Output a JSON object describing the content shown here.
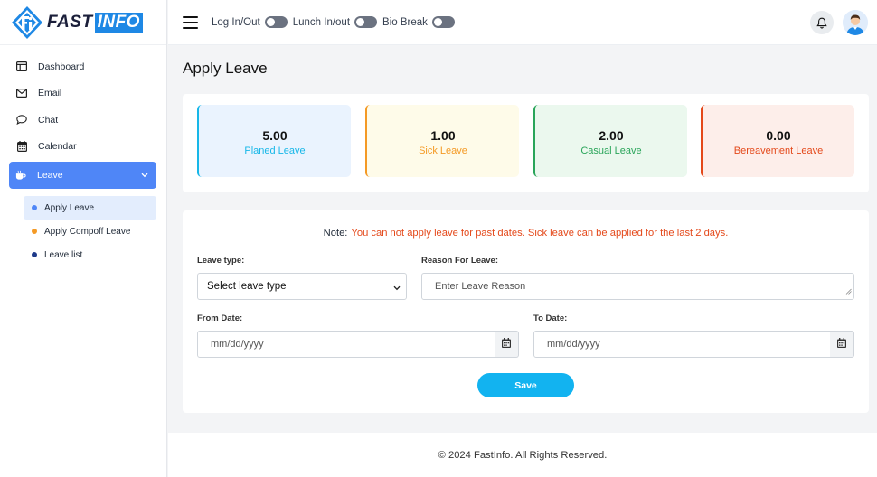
{
  "brand": {
    "name_part1": "FAST",
    "name_part2": "INFO",
    "colors": {
      "primary": "#1e88e5",
      "dark": "#1b1f3a"
    }
  },
  "sidebar": {
    "items": [
      {
        "label": "Dashboard",
        "icon": "dashboard-icon"
      },
      {
        "label": "Email",
        "icon": "mail-icon"
      },
      {
        "label": "Chat",
        "icon": "chat-icon"
      },
      {
        "label": "Calendar",
        "icon": "calendar-icon"
      },
      {
        "label": "Leave",
        "icon": "coffee-icon",
        "active": true
      }
    ],
    "leave_submenu": [
      {
        "label": "Apply Leave",
        "dot_color": "#4f86f7",
        "active": true
      },
      {
        "label": "Apply Compoff Leave",
        "dot_color": "#f49a25"
      },
      {
        "label": "Leave list",
        "dot_color": "#1e3a8a"
      }
    ]
  },
  "header": {
    "toggles": [
      {
        "label": "Log In/Out",
        "on": false
      },
      {
        "label": "Lunch In/out",
        "on": false
      },
      {
        "label": "Bio Break",
        "on": false
      }
    ]
  },
  "page": {
    "title": "Apply Leave"
  },
  "stats": [
    {
      "value": "5.00",
      "label": "Planed Leave",
      "color": "#17b7e8"
    },
    {
      "value": "1.00",
      "label": "Sick Leave",
      "color": "#f49a25"
    },
    {
      "value": "2.00",
      "label": "Casual Leave",
      "color": "#2aa55a"
    },
    {
      "value": "0.00",
      "label": "Bereavement Leave",
      "color": "#e4491b"
    }
  ],
  "form": {
    "note_label": "Note:",
    "note_text": "You can not apply leave for past dates. Sick leave can be applied for the last 2 days.",
    "leave_type_label": "Leave type:",
    "leave_type_value": "Select leave type",
    "reason_label": "Reason For Leave:",
    "reason_placeholder": "Enter Leave Reason",
    "from_label": "From Date:",
    "from_placeholder": "mm/dd/yyyy",
    "to_label": "To Date:",
    "to_placeholder": "mm/dd/yyyy",
    "save_label": "Save"
  },
  "footer": {
    "text": "© 2024 FastInfo. All Rights Reserved."
  }
}
